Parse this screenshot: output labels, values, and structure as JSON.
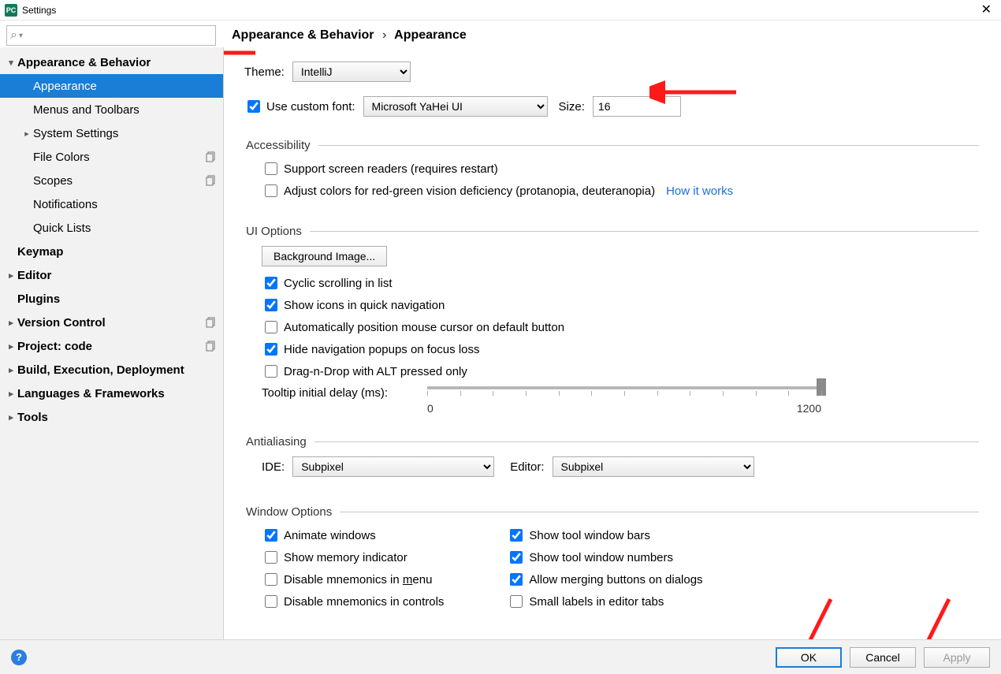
{
  "title": "Settings",
  "breadcrumb": {
    "root": "Appearance & Behavior",
    "leaf": "Appearance"
  },
  "sidebar": {
    "items": [
      {
        "label": "Appearance & Behavior",
        "bold": true,
        "exp": "down",
        "level": 0
      },
      {
        "label": "Appearance",
        "level": 1,
        "selected": true
      },
      {
        "label": "Menus and Toolbars",
        "level": 1
      },
      {
        "label": "System Settings",
        "level": 1,
        "exp": "right"
      },
      {
        "label": "File Colors",
        "level": 1,
        "copy": true
      },
      {
        "label": "Scopes",
        "level": 1,
        "copy": true
      },
      {
        "label": "Notifications",
        "level": 1
      },
      {
        "label": "Quick Lists",
        "level": 1
      },
      {
        "label": "Keymap",
        "bold": true,
        "level": 0
      },
      {
        "label": "Editor",
        "bold": true,
        "exp": "right",
        "level": 0
      },
      {
        "label": "Plugins",
        "bold": true,
        "level": 0
      },
      {
        "label": "Version Control",
        "bold": true,
        "exp": "right",
        "level": 0,
        "copy": true
      },
      {
        "label": "Project: code",
        "bold": true,
        "exp": "right",
        "level": 0,
        "copy": true
      },
      {
        "label": "Build, Execution, Deployment",
        "bold": true,
        "exp": "right",
        "level": 0
      },
      {
        "label": "Languages & Frameworks",
        "bold": true,
        "exp": "right",
        "level": 0
      },
      {
        "label": "Tools",
        "bold": true,
        "exp": "right",
        "level": 0
      }
    ]
  },
  "theme": {
    "label": "Theme:",
    "value": "IntelliJ"
  },
  "custom_font": {
    "label": "Use custom font:",
    "value": "Microsoft YaHei UI",
    "size_label": "Size:",
    "size_value": "16"
  },
  "accessibility": {
    "legend": "Accessibility",
    "screen_readers": "Support screen readers (requires restart)",
    "color_def": "Adjust colors for red-green vision deficiency (protanopia, deuteranopia)",
    "how": "How it works"
  },
  "ui_options": {
    "legend": "UI Options",
    "bg_image": "Background Image...",
    "cyclic": "Cyclic scrolling in list",
    "icons_quick": "Show icons in quick navigation",
    "auto_mouse": "Automatically position mouse cursor on default button",
    "hide_nav": "Hide navigation popups on focus loss",
    "dnd_alt": "Drag-n-Drop with ALT pressed only",
    "tooltip_label": "Tooltip initial delay (ms):",
    "tooltip_min": "0",
    "tooltip_max": "1200"
  },
  "antialiasing": {
    "legend": "Antialiasing",
    "ide_label": "IDE:",
    "ide_value": "Subpixel",
    "editor_label": "Editor:",
    "editor_value": "Subpixel"
  },
  "window_options": {
    "legend": "Window Options",
    "left": {
      "animate": "Animate windows",
      "memory": "Show memory indicator",
      "mnemonics_menu_pre": "Disable mnemonics in ",
      "mnemonics_menu_u": "m",
      "mnemonics_menu_post": "enu",
      "mnemonics_controls": "Disable mnemonics in controls"
    },
    "right": {
      "tool_bars": "Show tool window bars",
      "tool_numbers": "Show tool window numbers",
      "merge_buttons": "Allow merging buttons on dialogs",
      "small_labels": "Small labels in editor tabs"
    }
  },
  "footer": {
    "ok": "OK",
    "cancel": "Cancel",
    "apply": "Apply"
  }
}
